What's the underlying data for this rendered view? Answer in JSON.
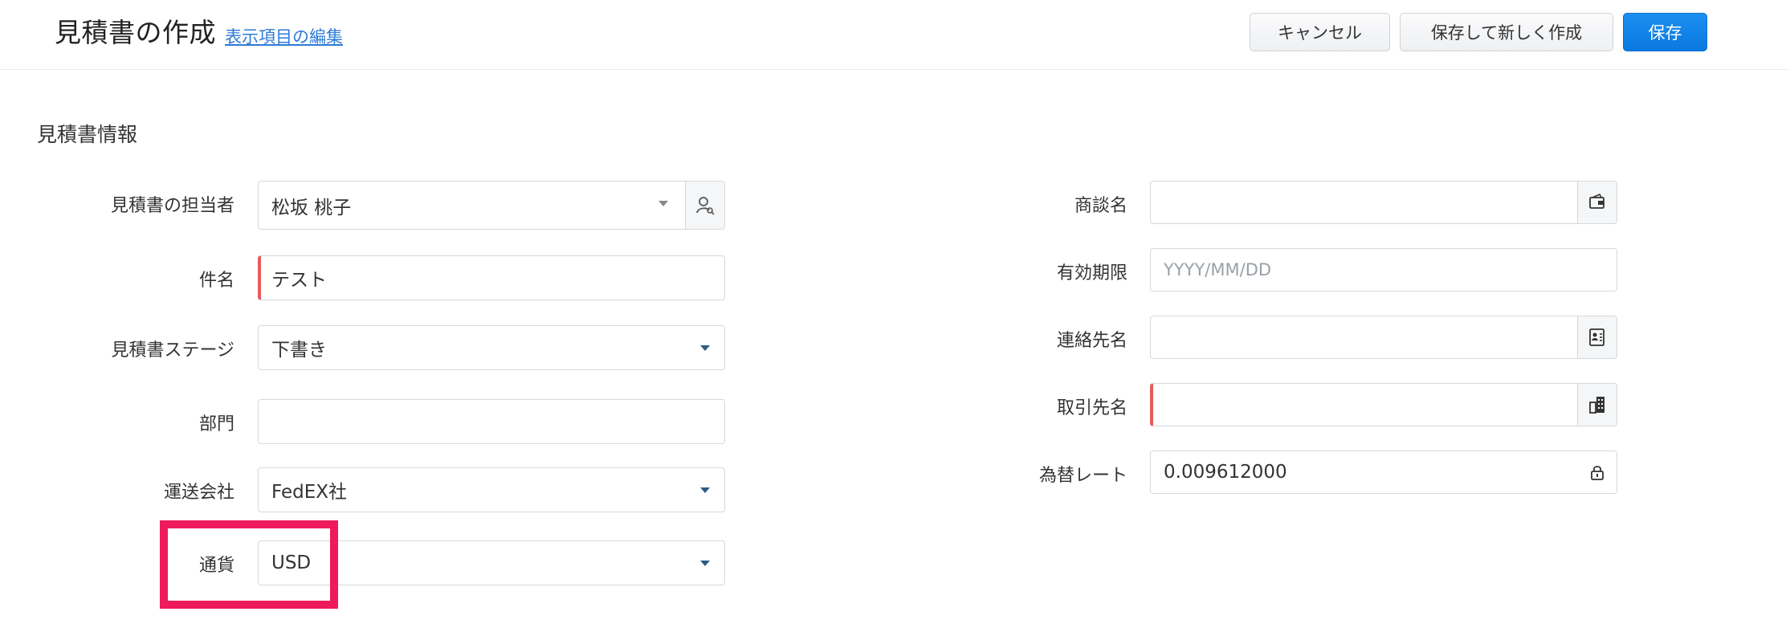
{
  "header": {
    "title": "見積書の作成",
    "edit_link": "表示項目の編集",
    "buttons": {
      "cancel": "キャンセル",
      "save_new": "保存して新しく作成",
      "save": "保存"
    }
  },
  "section": {
    "title": "見積書情報"
  },
  "left_fields": {
    "owner": {
      "label": "見積書の担当者",
      "value": "松坂 桃子",
      "icon": "user-search-icon"
    },
    "subject": {
      "label": "件名",
      "value": "テスト",
      "required": true
    },
    "stage": {
      "label": "見積書ステージ",
      "value": "下書き"
    },
    "department": {
      "label": "部門",
      "value": ""
    },
    "carrier": {
      "label": "運送会社",
      "value": "FedEX社"
    },
    "currency": {
      "label": "通貨",
      "value": "USD"
    }
  },
  "right_fields": {
    "deal": {
      "label": "商談名",
      "value": "",
      "icon": "wallet-icon"
    },
    "valid_until": {
      "label": "有効期限",
      "value": "",
      "placeholder": "YYYY/MM/DD"
    },
    "contact": {
      "label": "連絡先名",
      "value": "",
      "icon": "contact-card-icon"
    },
    "account": {
      "label": "取引先名",
      "value": "",
      "required": true,
      "icon": "building-icon"
    },
    "exchange_rate": {
      "label": "為替レート",
      "value": "0.009612000",
      "icon": "lock-icon"
    }
  },
  "colors": {
    "primary": "#0a78e0",
    "required": "#e55b5b",
    "highlight": "#ef1a5c",
    "link": "#2d7ad8"
  }
}
